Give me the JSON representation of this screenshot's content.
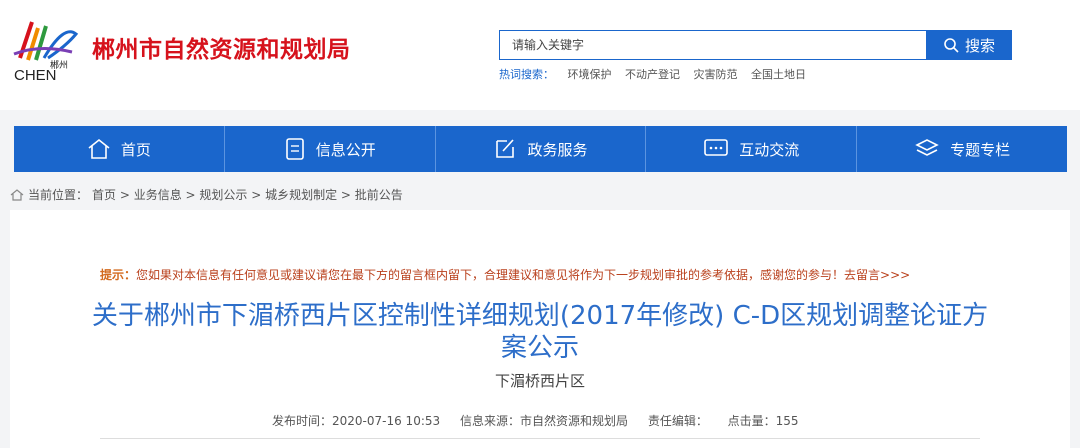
{
  "site": {
    "name": "郴州市自然资源和规划局",
    "logo_text": "郴州 CHEN"
  },
  "search": {
    "placeholder": "请输入关键字",
    "button": "搜索"
  },
  "hot": {
    "label": "热词搜索：",
    "terms": [
      "环境保护",
      "不动产登记",
      "灾害防范",
      "全国土地日"
    ]
  },
  "nav": [
    "首页",
    "信息公开",
    "政务服务",
    "互动交流",
    "专题专栏"
  ],
  "breadcrumb": {
    "prefix": "当前位置：",
    "path": "首页 > 业务信息 > 规划公示 > 城乡规划制定 > 批前公告"
  },
  "tip": {
    "label": "提示：",
    "text": "您如果对本信息有任何意见或建议请您在最下方的留言框内留下，合理建议和意见将作为下一步规划审批的参考依据，感谢您的参与！去留言>>>"
  },
  "article": {
    "title": "关于郴州市下湄桥西片区控制性详细规划(2017年修改) C-D区规划调整论证方案公示",
    "subtitle": "下湄桥西片区",
    "meta": {
      "published": "发布时间：2020-07-16 10:53",
      "source": "信息来源：市自然资源和规划局",
      "editor": "责任编辑：",
      "clicks": "点击量：155"
    }
  }
}
